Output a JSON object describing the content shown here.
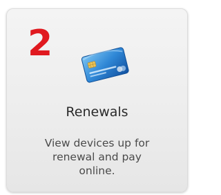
{
  "tile": {
    "step_number": "2",
    "title": "Renewals",
    "description_lines": [
      "View devices up for",
      "renewal and pay",
      "online."
    ],
    "icon": "credit-card-icon"
  },
  "colors": {
    "step_number": "#e0191f",
    "card_blue": "#1f6fc4",
    "tile_background": "#efefef"
  }
}
